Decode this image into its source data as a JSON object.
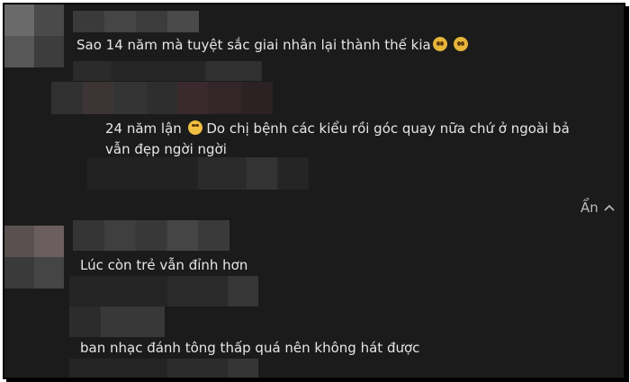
{
  "comments": [
    {
      "text": "Sao 14 năm mà tuyệt sắc giai nhân lại thành thế kia",
      "emojis": [
        "pleading-face-icon",
        "pleading-face-icon"
      ]
    },
    {
      "text_line1": "24 năm lận",
      "emoji": "laughing-face-icon",
      "text_line1_rest": "Do chị bệnh các kiểu rồi góc quay nữa chứ ở ngoài bả",
      "text_line2": "vẫn đẹp ngời ngời"
    },
    {
      "text": "Lúc còn trẻ vẫn đỉnh hơn"
    },
    {
      "text": "ban nhạc đánh tông thấp quá nên không hát được"
    }
  ],
  "toggle": {
    "label": "Ẩn",
    "icon": "chevron-up-icon"
  },
  "colors": {
    "background": "#1b1b1b",
    "text": "#e6e6e6",
    "muted": "#bdbdbd"
  }
}
